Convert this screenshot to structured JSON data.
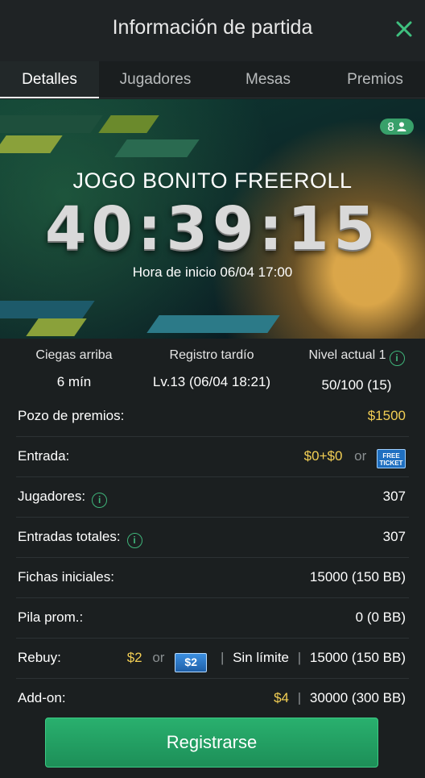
{
  "header": {
    "title": "Información de partida"
  },
  "tabs": [
    {
      "label": "Detalles",
      "active": true
    },
    {
      "label": "Jugadores",
      "active": false
    },
    {
      "label": "Mesas",
      "active": false
    },
    {
      "label": "Premios",
      "active": false
    }
  ],
  "banner": {
    "players_count": "8",
    "tournament_name": "JOGO BONITO FREEROLL",
    "countdown": "40:39:15",
    "start_time": "Hora de inicio 06/04 17:00"
  },
  "stats": {
    "blinds_label": "Ciegas arriba",
    "blinds_value": "6 mín",
    "late_reg_label": "Registro tardío",
    "late_reg_value": "Lv.13 (06/04 18:21)",
    "level_label": "Nivel actual 1",
    "level_value": "50/100 (15)"
  },
  "rows": {
    "prize_pool_label": "Pozo de premios:",
    "prize_pool_value": "$1500",
    "entry_label": "Entrada:",
    "entry_value": "$0+$0",
    "entry_or": "or",
    "entry_ticket_line1": "FREE",
    "entry_ticket_line2": "TICKET",
    "players_label": "Jugadores:",
    "players_value": "307",
    "total_entries_label": "Entradas totales:",
    "total_entries_value": "307",
    "starting_chips_label": "Fichas iniciales:",
    "starting_chips_value": "15000 (150 BB)",
    "avg_stack_label": "Pila prom.:",
    "avg_stack_value": "0 (0 BB)",
    "rebuy_label": "Rebuy:",
    "rebuy_price": "$2",
    "rebuy_or": "or",
    "rebuy_ticket": "$2",
    "rebuy_limit": "Sin límite",
    "rebuy_chips": "15000 (150 BB)",
    "addon_label": "Add-on:",
    "addon_price": "$4",
    "addon_chips": "30000 (300 BB)"
  },
  "footer": {
    "register_label": "Registrarse"
  },
  "colors": {
    "accent_green": "#29b06e",
    "gold": "#f3cf54",
    "background": "#1b1f20"
  }
}
